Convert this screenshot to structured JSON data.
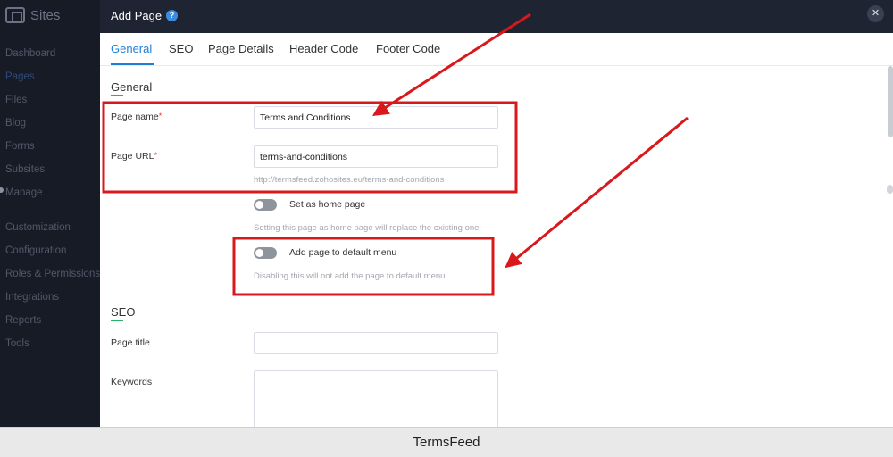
{
  "sidebar": {
    "title": "Sites",
    "items": [
      {
        "label": "Dashboard"
      },
      {
        "label": "Pages"
      },
      {
        "label": "Files"
      },
      {
        "label": "Blog"
      },
      {
        "label": "Forms"
      },
      {
        "label": "Subsites"
      },
      {
        "label": "Manage"
      },
      {
        "label": "Customization"
      },
      {
        "label": "Configuration"
      },
      {
        "label": "Roles & Permissions"
      },
      {
        "label": "Integrations"
      },
      {
        "label": "Reports"
      },
      {
        "label": "Tools"
      }
    ]
  },
  "modal": {
    "title": "Add Page",
    "help_icon": "?",
    "close_icon": "✕",
    "tabs": [
      {
        "label": "General"
      },
      {
        "label": "SEO"
      },
      {
        "label": "Page Details"
      },
      {
        "label": "Header Code"
      },
      {
        "label": "Footer Code"
      }
    ],
    "general": {
      "heading": "General",
      "page_name_label": "Page name",
      "page_name_value": "Terms and Conditions",
      "page_url_label": "Page URL",
      "page_url_value": "terms-and-conditions",
      "url_hint": "http://termsfeed.zohosites.eu/terms-and-conditions",
      "required_mark": "*",
      "home_toggle_label": "Set as home page",
      "home_hint": "Setting this page as home page will replace the existing one.",
      "menu_toggle_label": "Add page to default menu",
      "menu_hint": "Disabling this will not add the page to default menu."
    },
    "seo": {
      "heading": "SEO",
      "page_title_label": "Page title",
      "page_title_value": "",
      "keywords_label": "Keywords",
      "keywords_value": ""
    }
  },
  "annotation": {
    "color": "#d9181c"
  },
  "footer": {
    "brand": "TermsFeed"
  }
}
